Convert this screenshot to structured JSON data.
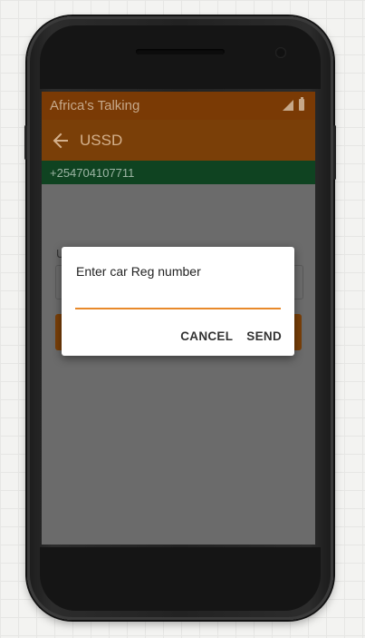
{
  "status_bar": {
    "title": "Africa's Talking",
    "icons": [
      "signal-icon",
      "battery-icon"
    ]
  },
  "app_bar": {
    "back_icon": "arrow-left-icon",
    "title": "USSD"
  },
  "phone_strip": {
    "number": "+254704107711"
  },
  "background_form": {
    "label": "U"
  },
  "dialog": {
    "title": "Enter car Reg number",
    "input_value": "",
    "cancel_label": "CANCEL",
    "send_label": "SEND"
  },
  "colors": {
    "status_bar": "#7a3a05",
    "app_bar": "#7a3f08",
    "phone_strip": "#0f4321",
    "dim_overlay": "#6b6b6b",
    "input_accent": "#e8892a"
  }
}
